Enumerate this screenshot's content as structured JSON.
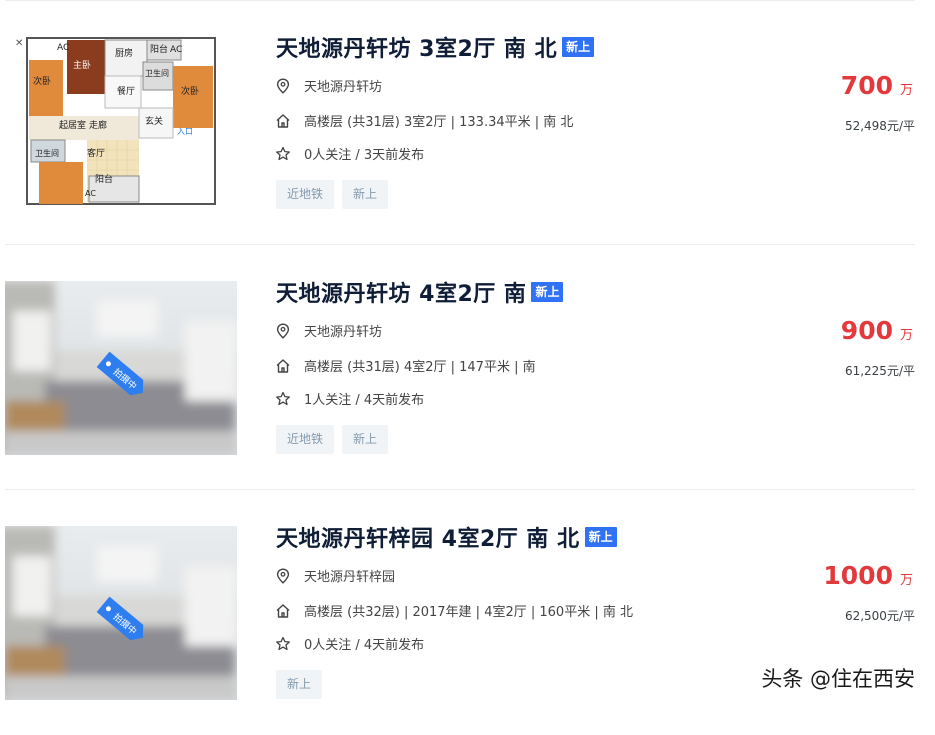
{
  "listings": [
    {
      "title": "天地源丹轩坊 3室2厅 南 北",
      "badge": "新上",
      "community": "天地源丹轩坊",
      "house_info": "高楼层 (共31层) 3室2厅 | 133.34平米 | 南 北",
      "follow_info": "0人关注 / 3天前发布",
      "tags": [
        "近地铁",
        "新上"
      ],
      "total_price": "700",
      "price_unit": "万",
      "unit_price": "52,498元/平",
      "image_type": "floorplan",
      "floorplan_labels": {
        "kitchen": "厨房",
        "dining": "餐厅",
        "balcony_top": "阳台",
        "ac_1": "AC",
        "ac_2": "AC",
        "ac_3": "AC",
        "bathroom_1": "卫生间",
        "bathroom_2": "卫生间",
        "master": "主卧",
        "second_left": "次卧",
        "second_right": "次卧",
        "living": "起居室",
        "corridor": "走廊",
        "living_room": "客厅",
        "entry": "玄关",
        "balcony_bottom": "阳台",
        "entrance": "入口"
      }
    },
    {
      "title": "天地源丹轩坊 4室2厅 南",
      "badge": "新上",
      "community": "天地源丹轩坊",
      "house_info": "高楼层 (共31层) 4室2厅 | 147平米 | 南",
      "follow_info": "1人关注 / 4天前发布",
      "tags": [
        "近地铁",
        "新上"
      ],
      "total_price": "900",
      "price_unit": "万",
      "unit_price": "61,225元/平",
      "image_type": "photo-placeholder",
      "photo_tag": "拍摄中"
    },
    {
      "title": "天地源丹轩梓园 4室2厅 南 北",
      "badge": "新上",
      "community": "天地源丹轩梓园",
      "house_info": "高楼层 (共32层) | 2017年建 | 4室2厅 | 160平米 | 南 北",
      "follow_info": "0人关注 / 4天前发布",
      "tags": [
        "新上"
      ],
      "total_price": "1000",
      "price_unit": "万",
      "unit_price": "62,500元/平",
      "image_type": "photo-placeholder",
      "photo_tag": "拍摄中"
    }
  ],
  "icons": {
    "location": "location-pin-icon",
    "house": "house-icon",
    "follow": "star-icon"
  },
  "colors": {
    "price": "#e4393c",
    "badge": "#3072f6",
    "title": "#101d37",
    "tag_text": "#849aae",
    "tag_bg": "#f1f4f6"
  },
  "watermark": "头条 @住在西安"
}
